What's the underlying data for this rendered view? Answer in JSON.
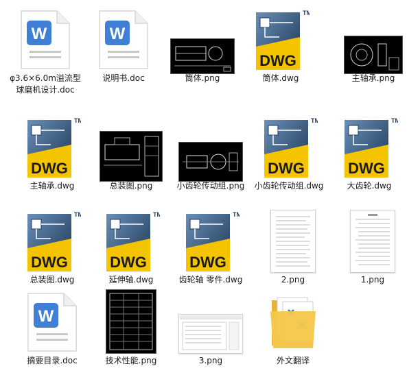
{
  "files": [
    {
      "name": "φ3.6×6.0m溢流型球磨机设计.doc",
      "type": "doc"
    },
    {
      "name": "说明书.doc",
      "type": "doc"
    },
    {
      "name": "筒体.png",
      "type": "png"
    },
    {
      "name": "筒体.dwg",
      "type": "dwg"
    },
    {
      "name": "主轴承.png",
      "type": "png"
    },
    {
      "name": "主轴承.dwg",
      "type": "dwg"
    },
    {
      "name": "总装图.png",
      "type": "png"
    },
    {
      "name": "小齿轮传动组.png",
      "type": "png"
    },
    {
      "name": "小齿轮传动组.dwg",
      "type": "dwg"
    },
    {
      "name": "大齿轮.dwg",
      "type": "dwg"
    },
    {
      "name": "总装图.dwg",
      "type": "dwg"
    },
    {
      "name": "延伸轴.dwg",
      "type": "dwg"
    },
    {
      "name": "齿轮轴 零件.dwg",
      "type": "dwg"
    },
    {
      "name": "2.png",
      "type": "png"
    },
    {
      "name": "1.png",
      "type": "png"
    },
    {
      "name": "摘要目录.doc",
      "type": "doc"
    },
    {
      "name": "技术性能.png",
      "type": "png"
    },
    {
      "name": "3.png",
      "type": "png"
    },
    {
      "name": "外文翻译",
      "type": "folder"
    }
  ],
  "icons": {
    "doc_letter": "W",
    "dwg_text": "DWG",
    "dwg_tm": "TM"
  },
  "colors": {
    "word_blue": "#3f7fd6",
    "dwg_yellow": "#f5c400",
    "dwg_navy": "#1e3a5f",
    "folder_yellow": "#f4c74a"
  }
}
